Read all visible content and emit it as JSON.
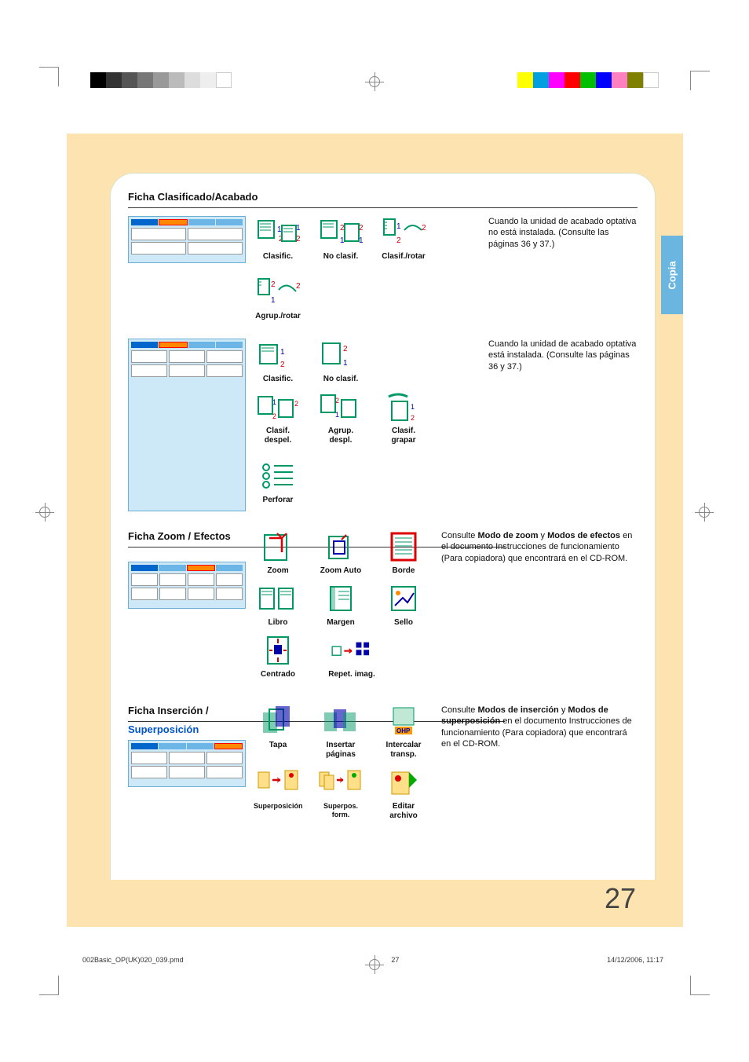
{
  "meta": {
    "side_tab": "Copia",
    "page_number": "27",
    "footer_file": "002Basic_OP(UK)020_039.pmd",
    "footer_page": "27",
    "footer_date": "14/12/2006, 11:17"
  },
  "sections": {
    "clasificado": {
      "title": "Ficha Clasificado/Acabado",
      "options_row1": [
        "Clasific.",
        "No clasif.",
        "Clasif./rotar",
        "Agrup./rotar"
      ],
      "note1": "Cuando la unidad de acabado optativa no está instalada.\n(Consulte las páginas 36 y 37.)",
      "options_row2": [
        "Clasific.",
        "No clasif."
      ],
      "options_row3": [
        "Clasif. despel.",
        "Agrup. despl.",
        "Clasif. grapar",
        "Perforar"
      ],
      "note2": "Cuando la unidad de acabado optativa está instalada.\n(Consulte las páginas 36 y 37.)"
    },
    "zoom": {
      "title": "Ficha Zoom / Efectos",
      "options_row1": [
        "Zoom",
        "Zoom Auto",
        "Borde"
      ],
      "options_row2": [
        "Libro",
        "Margen",
        "Sello"
      ],
      "options_row3": [
        "Centrado",
        "Repet. imag."
      ],
      "note_pre": "Consulte ",
      "note_bold1": "Modo de zoom",
      "note_mid": " y ",
      "note_bold2": "Modos de efectos",
      "note_post": " en el documento Instrucciones de funcionamiento (Para copiadora) que encontrará en el CD-ROM."
    },
    "insercion": {
      "title_a": "Ficha Inserción /",
      "title_b": "Superposición",
      "options_row1": [
        "Tapa",
        "Insertar páginas",
        "Intercalar transp."
      ],
      "options_row2": [
        "Superposición",
        "Superpos. form.",
        "Editar archivo"
      ],
      "note_pre": "Consulte ",
      "note_bold1": "Modos de inserción",
      "note_mid": " y ",
      "note_bold2": "Modos de superposición",
      "note_post": " en el documento Instrucciones de funcionamiento (Para copiadora) que encontrará en el CD-ROM."
    }
  },
  "colorbar_left": [
    "#000",
    "#333",
    "#555",
    "#777",
    "#999",
    "#bbb",
    "#ddd",
    "#f0f0f0",
    "#fff"
  ],
  "colorbar_right": [
    "#ffff00",
    "#00a0e0",
    "#ff00ff",
    "#ff0000",
    "#00c000",
    "#0000ff",
    "#ff80c0",
    "#808000",
    "#fff"
  ]
}
